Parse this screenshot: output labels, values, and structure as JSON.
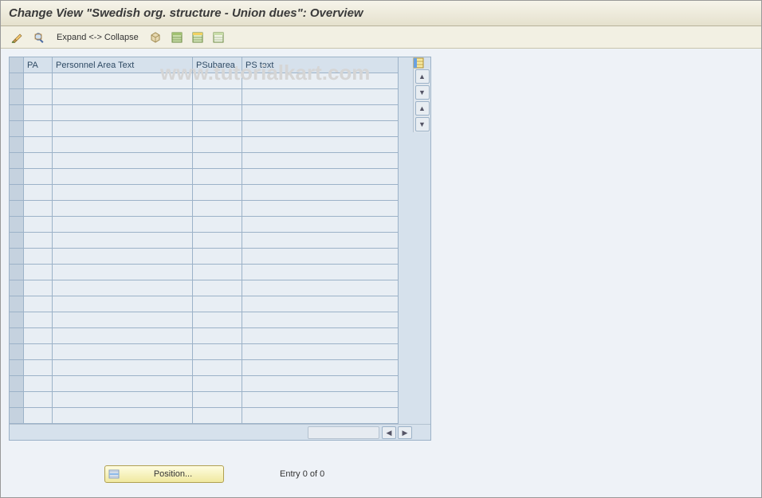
{
  "title": "Change View \"Swedish org. structure - Union dues\": Overview",
  "toolbar": {
    "expand_collapse_label": "Expand <-> Collapse"
  },
  "watermark": "www.tutorialkart.com",
  "table": {
    "columns": {
      "pa": "PA",
      "pat": "Personnel Area Text",
      "ps": "PSubarea",
      "pst": "PS text"
    },
    "row_count": 22
  },
  "footer": {
    "position_label": "Position...",
    "entry_text": "Entry 0 of 0"
  }
}
